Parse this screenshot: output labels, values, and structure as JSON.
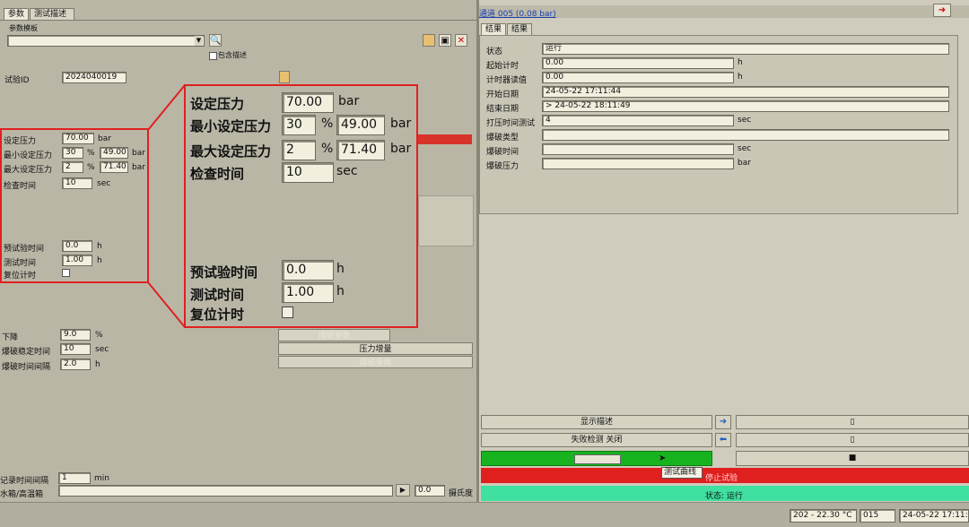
{
  "left_tabs": [
    "参数",
    "测试描述"
  ],
  "param_template_label": "参数模板",
  "include_desc_label": "包含描述",
  "test_id": {
    "label": "试验ID",
    "value": "2024040019"
  },
  "params": {
    "set_pressure": {
      "label": "设定压力",
      "value": "70.00",
      "unit": "bar"
    },
    "min_set": {
      "label": "最小设定压力",
      "pct": "30",
      "pct_unit": "%",
      "value": "49.00",
      "unit": "bar"
    },
    "max_set": {
      "label": "最大设定压力",
      "pct": "2",
      "pct_unit": "%",
      "value": "71.40",
      "unit": "bar"
    },
    "check_time": {
      "label": "检查时间",
      "value": "10",
      "unit": "sec"
    },
    "pre_test_time": {
      "label": "预试验时间",
      "value": "0.0",
      "unit": "h"
    },
    "test_time": {
      "label": "测试时间",
      "value": "1.00",
      "unit": "h"
    },
    "reset_timer": {
      "label": "复位计时"
    }
  },
  "zoom_box": {
    "set_pressure_label": "设定压力",
    "set_pressure_value": "70.00",
    "set_pressure_unit": "bar",
    "min_label": "最小设定压力",
    "min_pct": "30",
    "min_value": "49.00",
    "min_unit": "bar",
    "pct_unit": "%",
    "max_label": "最大设定压力",
    "max_pct": "2",
    "max_value": "71.40",
    "max_unit": "bar",
    "check_label": "检查时间",
    "check_value": "10",
    "check_unit": "sec",
    "pre_label": "预试验时间",
    "pre_value": "0.0",
    "pre_unit": "h",
    "test_label": "测试时间",
    "test_value": "1.00",
    "test_unit": "h",
    "reset_label": "复位计时"
  },
  "drop": {
    "label": "下降",
    "value": "9.0",
    "unit": "%"
  },
  "burst_stable": {
    "label": "爆破稳定时间",
    "value": "10",
    "unit": "sec"
  },
  "burst_interval": {
    "label": "爆破时间间隔",
    "value": "2.0",
    "unit": "h"
  },
  "mid_buttons": {
    "b1": "爆破参数",
    "b2": "压力增量",
    "b3": "爆破参数"
  },
  "record_interval": {
    "label": "记录时间间隔",
    "value": "1",
    "unit": "min"
  },
  "water_tank": {
    "label": "水箱/高温箱",
    "temp_value": "0.0",
    "unit": "摄氏度"
  },
  "right_header": "通道 005 (0.08 bar)",
  "right_tabs": [
    "结果",
    "结果"
  ],
  "results": [
    {
      "label": "状态",
      "value": "运行",
      "unit": ""
    },
    {
      "label": "起始计时",
      "value": "0.00",
      "unit": "h"
    },
    {
      "label": "计时器读值",
      "value": "0.00",
      "unit": "h"
    },
    {
      "label": "开始日期",
      "value": "24-05-22 17:11:44",
      "unit": ""
    },
    {
      "label": "结束日期",
      "value": "> 24-05-22 18:11:49",
      "unit": ""
    },
    {
      "label": "打压时间测试",
      "value": "4",
      "unit": "sec"
    },
    {
      "label": "爆破类型",
      "value": "",
      "unit": ""
    },
    {
      "label": "爆破时间",
      "value": "",
      "unit": "sec"
    },
    {
      "label": "爆破压力",
      "value": "",
      "unit": "bar"
    }
  ],
  "right_buttons": {
    "show_desc": "显示描述",
    "fail_detect": "失败检测 关闭",
    "test_curve_tooltip": "测试曲线",
    "stop_test": "停止试验",
    "status_bar": "状态: 运行"
  },
  "taskbar": {
    "temp": "202 - 22.30 °C",
    "code": "015",
    "datetime": "24-05-22 17:11:52"
  },
  "colors": {
    "accent_red": "#e02020",
    "green": "#17b31f",
    "teal": "#3fe0a0",
    "red_bar": "#d8332b"
  }
}
